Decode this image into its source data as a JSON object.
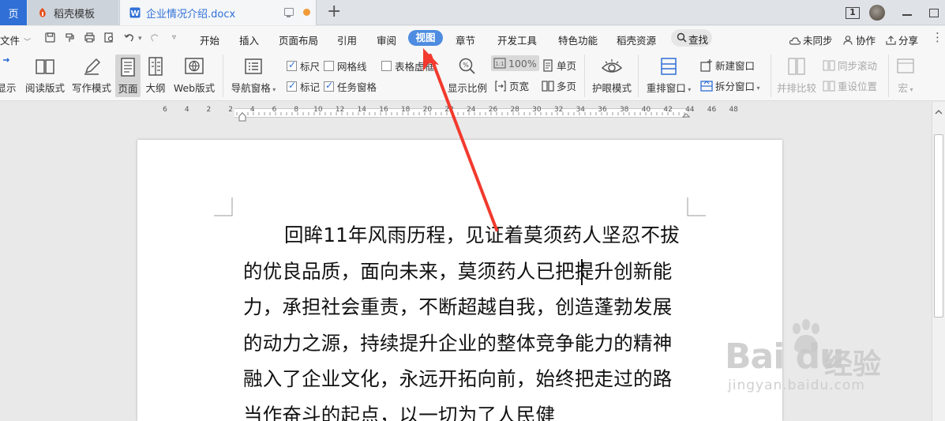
{
  "tabs": {
    "prev_label": "页",
    "template_label": "稻壳模板",
    "doc_label": "企业情况介绍.docx",
    "new_tab": "+"
  },
  "window": {
    "badge": "1"
  },
  "menu": {
    "file": "文件",
    "items": [
      "开始",
      "插入",
      "页面布局",
      "引用",
      "审阅",
      "视图",
      "章节",
      "开发工具",
      "特色功能",
      "稻壳资源"
    ],
    "search": "查找",
    "sync": "未同步",
    "collab": "协作",
    "share": "分享"
  },
  "ribbon": {
    "display": "显示",
    "read_mode": "阅读版式",
    "write_mode": "写作模式",
    "page": "页面",
    "outline": "大纲",
    "web_layout": "Web版式",
    "nav_pane": "导航窗格",
    "ruler": "标尺",
    "gridlines": "网格线",
    "table_virtual": "表格虚框",
    "marks": "标记",
    "task_pane": "任务窗格",
    "zoom_label": "显示比例",
    "zoom_value": "100%",
    "page_width": "页宽",
    "single_page": "单页",
    "multi_page": "多页",
    "eye_mode": "护眼模式",
    "arrange_windows": "重排窗口",
    "new_window": "新建窗口",
    "split_window": "拆分窗口",
    "side_by_side": "并排比较",
    "sync_scroll": "同步滚动",
    "reset_position": "重设位置",
    "macro": "宏"
  },
  "checkbox_state": {
    "ruler": true,
    "gridlines": false,
    "table_virtual": false,
    "marks": true,
    "task_pane": true
  },
  "ruler": {
    "labels": [
      "6",
      "4",
      "2",
      "2",
      "4",
      "6",
      "8",
      "10",
      "12",
      "14",
      "16",
      "18",
      "20",
      "22",
      "24",
      "26",
      "28",
      "30",
      "32",
      "34",
      "36",
      "38",
      "40",
      "42",
      "44",
      "46",
      "48"
    ]
  },
  "document": {
    "paragraph": "回眸11年风雨历程，见证着莫须药人坚忍不拔的优良品质，面向未来，莫须药人已把提升创新能力，承担社会重责，不断超越自我，创造蓬勃发展的动力之源，持续提升企业的整体竞争能力的精神融入了企业文化，永远开拓向前，始终把走过的路当作奋斗的起点，以一切为了人民健"
  },
  "watermark": {
    "brand": "Bai du",
    "jingyan": "经验",
    "url": "jingyan.baidu.com"
  },
  "colors": {
    "accent": "#4d8ce0",
    "arrow": "#f23a2e",
    "tab_active_text": "#2f6fd6"
  }
}
